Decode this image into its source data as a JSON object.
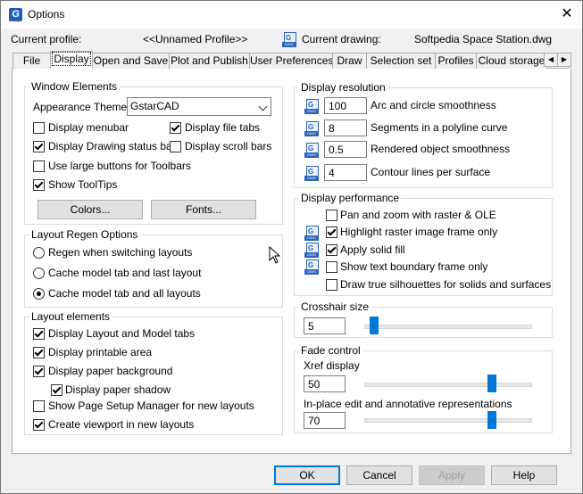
{
  "window": {
    "title": "Options",
    "close_glyph": "✕"
  },
  "header": {
    "current_profile_label": "Current profile:",
    "current_profile_value": "<<Unnamed Profile>>",
    "current_drawing_label": "Current drawing:",
    "current_drawing_value": "Softpedia Space Station.dwg"
  },
  "tabs": [
    "File",
    "Display",
    "Open and Save",
    "Plot and Publish",
    "User Preferences",
    "Draw",
    "Selection set",
    "Profiles",
    "Cloud storage"
  ],
  "active_tab": "Display",
  "window_elements": {
    "title": "Window Elements",
    "appearance_theme_label": "Appearance Theme:",
    "appearance_theme_value": "GstarCAD",
    "display_menubar": "Display menubar",
    "display_file_tabs": "Display file tabs",
    "display_drawing_status_bar": "Display Drawing status bar",
    "display_scroll_bars": "Display scroll bars",
    "use_large_buttons": "Use large buttons for Toolbars",
    "show_tooltips": "Show ToolTips",
    "colors_button": "Colors...",
    "fonts_button": "Fonts..."
  },
  "layout_regen": {
    "title": "Layout Regen Options",
    "opt1": "Regen when switching layouts",
    "opt2": "Cache model tab and last layout",
    "opt3": "Cache model tab and all layouts"
  },
  "layout_elements": {
    "title": "Layout elements",
    "item1": "Display Layout and Model tabs",
    "item2": "Display printable area",
    "item3": "Display paper background",
    "item4": "Display paper shadow",
    "item5": "Show Page Setup Manager for new layouts",
    "item6": "Create viewport in new layouts"
  },
  "display_resolution": {
    "title": "Display resolution",
    "arc_value": "100",
    "arc_label": "Arc and circle smoothness",
    "seg_value": "8",
    "seg_label": "Segments in a polyline curve",
    "obj_value": "0.5",
    "obj_label": "Rendered object smoothness",
    "contour_value": "4",
    "contour_label": "Contour lines per surface"
  },
  "display_performance": {
    "title": "Display performance",
    "item1": "Pan and zoom with raster & OLE",
    "item2": "Highlight raster image frame only",
    "item3": "Apply solid fill",
    "item4": "Show text boundary frame only",
    "item5": "Draw true silhouettes for solids and surfaces"
  },
  "crosshair": {
    "title": "Crosshair size",
    "value": "5"
  },
  "fade_control": {
    "title": "Fade control",
    "xref_label": "Xref display",
    "xref_value": "50",
    "inplace_label": "In-place edit and annotative representations",
    "inplace_value": "70"
  },
  "buttons": {
    "ok": "OK",
    "cancel": "Cancel",
    "apply": "Apply",
    "help": "Help"
  },
  "icons": {
    "app": "gstarcad-logo-icon",
    "dwg": "dwg-file-icon",
    "cursor": "mouse-pointer-icon"
  },
  "colors": {
    "accent": "#0078d7",
    "dwg_icon": "#2c63b8"
  }
}
